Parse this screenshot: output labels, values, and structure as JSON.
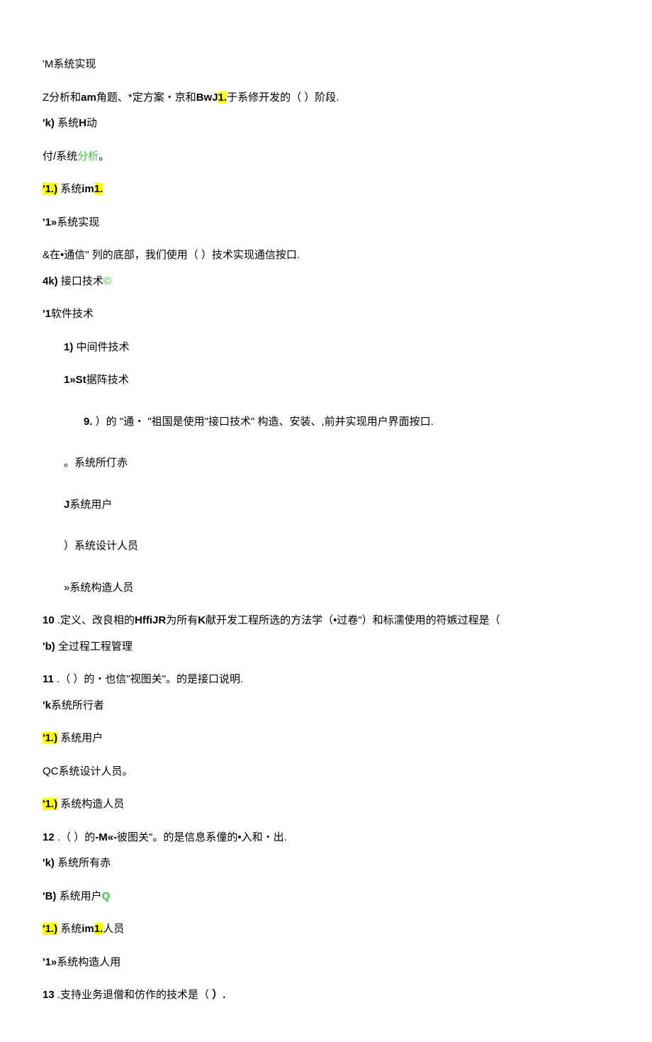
{
  "lines": [
    {
      "cls": "para-gap",
      "parts": [
        {
          "t": "'M系统实现"
        }
      ]
    },
    {
      "cls": "line",
      "parts": [
        {
          "t": "Z分析和"
        },
        {
          "t": "am",
          "bold": true
        },
        {
          "t": "角题、*定方案・京和"
        },
        {
          "t": "BwJ",
          "bold": true
        },
        {
          "t": "1.",
          "hl": true
        },
        {
          "t": "于系修开发的（                        ）阶段."
        }
      ]
    },
    {
      "cls": "para-gap",
      "parts": [
        {
          "t": "'k)",
          "bold": true
        },
        {
          "t": " 系统"
        },
        {
          "t": "H",
          "bold": true
        },
        {
          "t": "动"
        }
      ]
    },
    {
      "cls": "para-gap",
      "parts": [
        {
          "t": "付/系统"
        },
        {
          "t": "分析",
          "green": true
        },
        {
          "t": "。"
        }
      ]
    },
    {
      "cls": "para-gap",
      "parts": [
        {
          "t": "'1.)",
          "hl": true
        },
        {
          "t": " 系统"
        },
        {
          "t": "im",
          "bold": true
        },
        {
          "t": "1.",
          "hl": true
        }
      ]
    },
    {
      "cls": "para-gap",
      "parts": [
        {
          "t": "'1»",
          "bold": true
        },
        {
          "t": "系统实现"
        }
      ]
    },
    {
      "cls": "line",
      "parts": [
        {
          "t": "&在•通信\" 列的底部，我们使用（                 ）技术实现通信按口."
        }
      ]
    },
    {
      "cls": "para-gap",
      "parts": [
        {
          "t": "4k)",
          "bold": true
        },
        {
          "t": " 接口技术"
        },
        {
          "t": "©",
          "green": true
        }
      ]
    },
    {
      "cls": "para-gap",
      "parts": [
        {
          "t": "'1",
          "bold": true
        },
        {
          "t": "软件技术"
        }
      ]
    },
    {
      "cls": "para-gap indent1",
      "parts": [
        {
          "t": "1)",
          "bold": true
        },
        {
          "t": " 中间件技术"
        }
      ]
    },
    {
      "cls": "big-gap indent1",
      "parts": [
        {
          "t": "1»St",
          "bold": true
        },
        {
          "t": "据阵技术"
        }
      ]
    },
    {
      "cls": "big-gap indent2",
      "parts": [
        {
          "t": "9.",
          "bold": true
        },
        {
          "t": "                         ）的 \"通・ \"祖国是使用\"接口技术\" 构造、安装、,前并实现用户界面按口."
        }
      ]
    },
    {
      "cls": "big-gap indent1",
      "parts": [
        {
          "t": "。系统所仃赤"
        }
      ]
    },
    {
      "cls": "big-gap indent1",
      "parts": [
        {
          "t": "J",
          "bold": true
        },
        {
          "t": "系统用户"
        }
      ]
    },
    {
      "cls": "big-gap indent1",
      "parts": [
        {
          "t": "）系统设计人员"
        }
      ]
    },
    {
      "cls": "para-gap indent1",
      "parts": [
        {
          "t": "»系统构造人员"
        }
      ]
    },
    {
      "cls": "line",
      "parts": [
        {
          "t": "10",
          "bold": true
        },
        {
          "t": "  .定义、改良相的"
        },
        {
          "t": "HffiJR",
          "bold": true
        },
        {
          "t": "为所有"
        },
        {
          "t": "K",
          "bold": true
        },
        {
          "t": "献开发工程所选的方法学（•过卷\"）和标濡使用的符嫉过程是（"
        }
      ]
    },
    {
      "cls": "para-gap",
      "parts": [
        {
          "t": "'b)",
          "bold": true
        },
        {
          "t": " 全过程工程管理"
        }
      ]
    },
    {
      "cls": "line",
      "parts": [
        {
          "t": "11",
          "bold": true
        },
        {
          "t": "  .（         ）的・也信\"视图关\"。的是接口说明."
        }
      ]
    },
    {
      "cls": "para-gap",
      "parts": [
        {
          "t": "'k",
          "bold": true
        },
        {
          "t": "系统所行者"
        }
      ]
    },
    {
      "cls": "para-gap",
      "parts": [
        {
          "t": "'1.)",
          "hl": true
        },
        {
          "t": " 系统用户"
        }
      ]
    },
    {
      "cls": "para-gap",
      "parts": [
        {
          "t": "QC",
          "italic": true
        },
        {
          "t": "系统设计人员。"
        }
      ]
    },
    {
      "cls": "para-gap",
      "parts": [
        {
          "t": "'1.)",
          "hl": true
        },
        {
          "t": " 系统构造人员"
        }
      ]
    },
    {
      "cls": "line",
      "parts": [
        {
          "t": "12",
          "bold": true
        },
        {
          "t": "  .（         ）的"
        },
        {
          "t": "-M«-",
          "bold": true
        },
        {
          "t": "彼图关\"。的是信息系僮的•入和・出."
        }
      ]
    },
    {
      "cls": "para-gap",
      "parts": [
        {
          "t": "'k)",
          "bold": true
        },
        {
          "t": " 系统所有赤"
        }
      ]
    },
    {
      "cls": "para-gap",
      "parts": [
        {
          "t": "'B)",
          "bold": true
        },
        {
          "t": " 系统用户"
        },
        {
          "t": "Q",
          "green": true,
          "bold": true
        }
      ]
    },
    {
      "cls": "para-gap",
      "parts": [
        {
          "t": "'1.)",
          "hl": true
        },
        {
          "t": " 系统"
        },
        {
          "t": "im",
          "bold": true
        },
        {
          "t": "1.",
          "hl": true
        },
        {
          "t": "人员"
        }
      ]
    },
    {
      "cls": "para-gap",
      "parts": [
        {
          "t": "'1»",
          "bold": true
        },
        {
          "t": "系统构造人用"
        }
      ]
    },
    {
      "cls": "line",
      "parts": [
        {
          "t": "13",
          "bold": true
        },
        {
          "t": "  .支持业务退僧和仿作的技术是（               "
        },
        {
          "t": "）.",
          "bold": true
        }
      ]
    }
  ]
}
